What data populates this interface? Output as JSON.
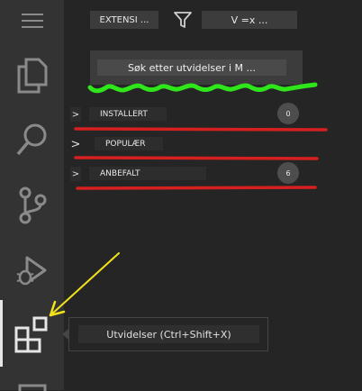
{
  "header": {
    "extensions_button_label": "EXTENSI ...",
    "views_button_label": "V =x ..."
  },
  "search": {
    "placeholder": "Søk etter utvidelser i M ..."
  },
  "sections": [
    {
      "label": "INSTALLERT",
      "count": "0",
      "chevron": ">"
    },
    {
      "label": "POPULÆR",
      "chevron": ">"
    },
    {
      "label": "ANBEFALT",
      "count": "6",
      "chevron": ">"
    }
  ],
  "tooltip": {
    "text": "Utvidelser (Ctrl+Shift+X)"
  },
  "activity_bar": {
    "items": [
      "menu-icon",
      "explorer-icon",
      "search-icon",
      "source-control-icon",
      "run-debug-icon",
      "extensions-icon",
      "accounts-icon"
    ]
  },
  "annotation_colors": {
    "highlight": "#2ee61a",
    "underline": "#d62020",
    "arrow": "#f2e21a"
  }
}
